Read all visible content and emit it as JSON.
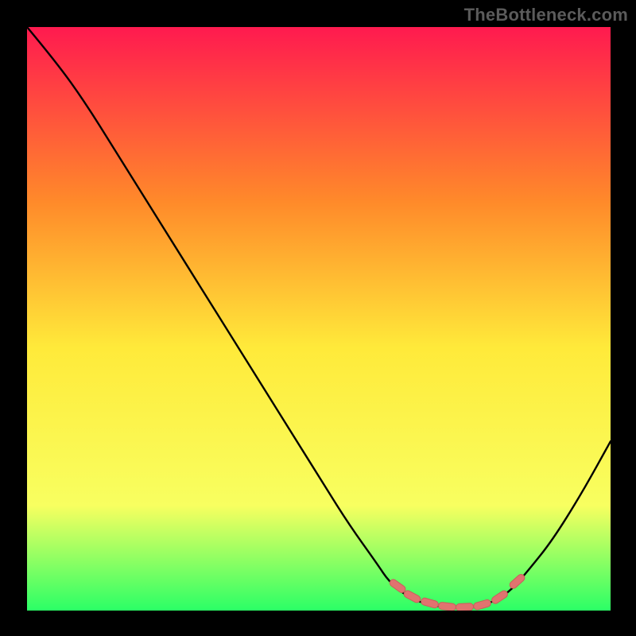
{
  "watermark": "TheBottleneck.com",
  "colors": {
    "bg": "#000000",
    "grad_top": "#ff1a4f",
    "grad_upper_mid": "#ff8a2a",
    "grad_mid": "#ffea3a",
    "grad_lower": "#f8ff60",
    "grad_bottom": "#2bff66",
    "curve": "#000000",
    "marker_fill": "#e0736f",
    "marker_stroke": "#c95f5b"
  },
  "chart_data": {
    "type": "line",
    "title": "",
    "xlabel": "",
    "ylabel": "",
    "xlim": [
      0,
      100
    ],
    "ylim": [
      0,
      100
    ],
    "series": [
      {
        "name": "bottleneck-curve",
        "x": [
          0,
          5,
          10,
          15,
          20,
          25,
          30,
          35,
          40,
          45,
          50,
          55,
          60,
          62,
          65,
          68,
          71,
          74,
          77,
          80,
          83,
          86,
          90,
          95,
          100
        ],
        "y": [
          100,
          94,
          87,
          79,
          71,
          63,
          55,
          47,
          39,
          31,
          23,
          15,
          8,
          5,
          2.5,
          1.2,
          0.6,
          0.5,
          0.7,
          1.5,
          3.5,
          7,
          12,
          20,
          29
        ]
      }
    ],
    "markers": {
      "name": "optimal-range",
      "x": [
        63.5,
        66,
        69,
        72,
        75,
        78,
        81,
        84
      ],
      "y": [
        4.2,
        2.4,
        1.3,
        0.7,
        0.6,
        1.0,
        2.3,
        5.0
      ]
    }
  }
}
